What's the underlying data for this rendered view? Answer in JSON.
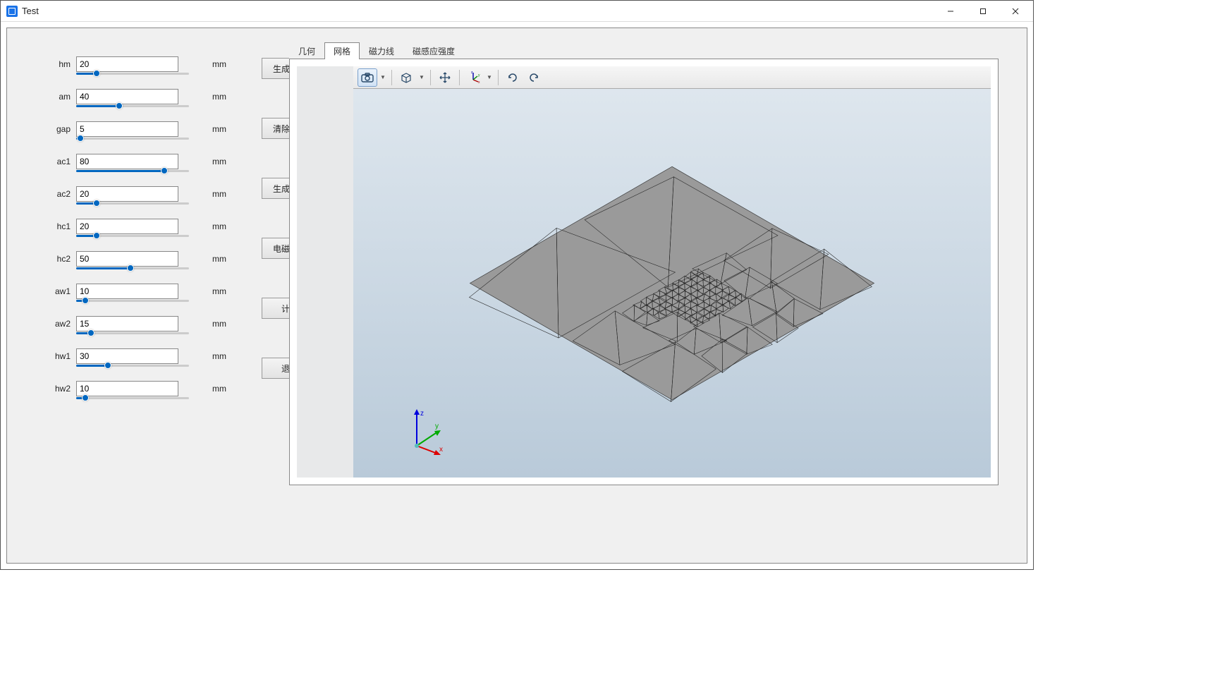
{
  "window": {
    "title": "Test"
  },
  "parameters": [
    {
      "label": "hm",
      "value": "20",
      "unit": "mm",
      "fillPct": 18
    },
    {
      "label": "am",
      "value": "40",
      "unit": "mm",
      "fillPct": 38
    },
    {
      "label": "gap",
      "value": "5",
      "unit": "mm",
      "fillPct": 4
    },
    {
      "label": "ac1",
      "value": "80",
      "unit": "mm",
      "fillPct": 78
    },
    {
      "label": "ac2",
      "value": "20",
      "unit": "mm",
      "fillPct": 18
    },
    {
      "label": "hc1",
      "value": "20",
      "unit": "mm",
      "fillPct": 18
    },
    {
      "label": "hc2",
      "value": "50",
      "unit": "mm",
      "fillPct": 48
    },
    {
      "label": "aw1",
      "value": "10",
      "unit": "mm",
      "fillPct": 8
    },
    {
      "label": "aw2",
      "value": "15",
      "unit": "mm",
      "fillPct": 13
    },
    {
      "label": "hw1",
      "value": "30",
      "unit": "mm",
      "fillPct": 28
    },
    {
      "label": "hw2",
      "value": "10",
      "unit": "mm",
      "fillPct": 8
    }
  ],
  "actions": {
    "generate_geometry": "生成几何",
    "clear_geometry": "清除几何",
    "generate_mesh": "生成网格",
    "em_params": "电磁参数",
    "compute": "计算",
    "exit": "退出"
  },
  "tabs": [
    {
      "id": "geometry",
      "label": "几何",
      "active": false
    },
    {
      "id": "mesh",
      "label": "网格",
      "active": true
    },
    {
      "id": "fieldlines",
      "label": "磁力线",
      "active": false
    },
    {
      "id": "fluxdensity",
      "label": "磁感应强度",
      "active": false
    }
  ],
  "axes": {
    "x": "x",
    "y": "y",
    "z": "z"
  }
}
